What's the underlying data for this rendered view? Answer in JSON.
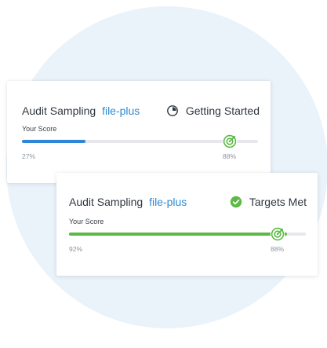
{
  "colors": {
    "background_circle": "#eaf2fa",
    "link": "#2d8ad6",
    "progress_in_progress": "#2f86d8",
    "progress_met": "#5cb946",
    "target_icon": "#5cb946",
    "track": "#e6e8eb"
  },
  "cards": [
    {
      "title": "Audit Sampling",
      "link": "file-plus",
      "status": {
        "label": "Getting Started",
        "icon": "partial-clock-icon"
      },
      "score_label": "Your Score",
      "score_pct": 27,
      "score_text": "27%",
      "target_pct": 88,
      "target_text": "88%",
      "fill_color": "#2f86d8"
    },
    {
      "title": "Audit Sampling",
      "link": "file-plus",
      "status": {
        "label": "Targets Met",
        "icon": "check-circle-icon"
      },
      "score_label": "Your Score",
      "score_pct": 92,
      "score_text": "92%",
      "target_pct": 88,
      "target_text": "88%",
      "fill_color": "#5cb946"
    }
  ]
}
